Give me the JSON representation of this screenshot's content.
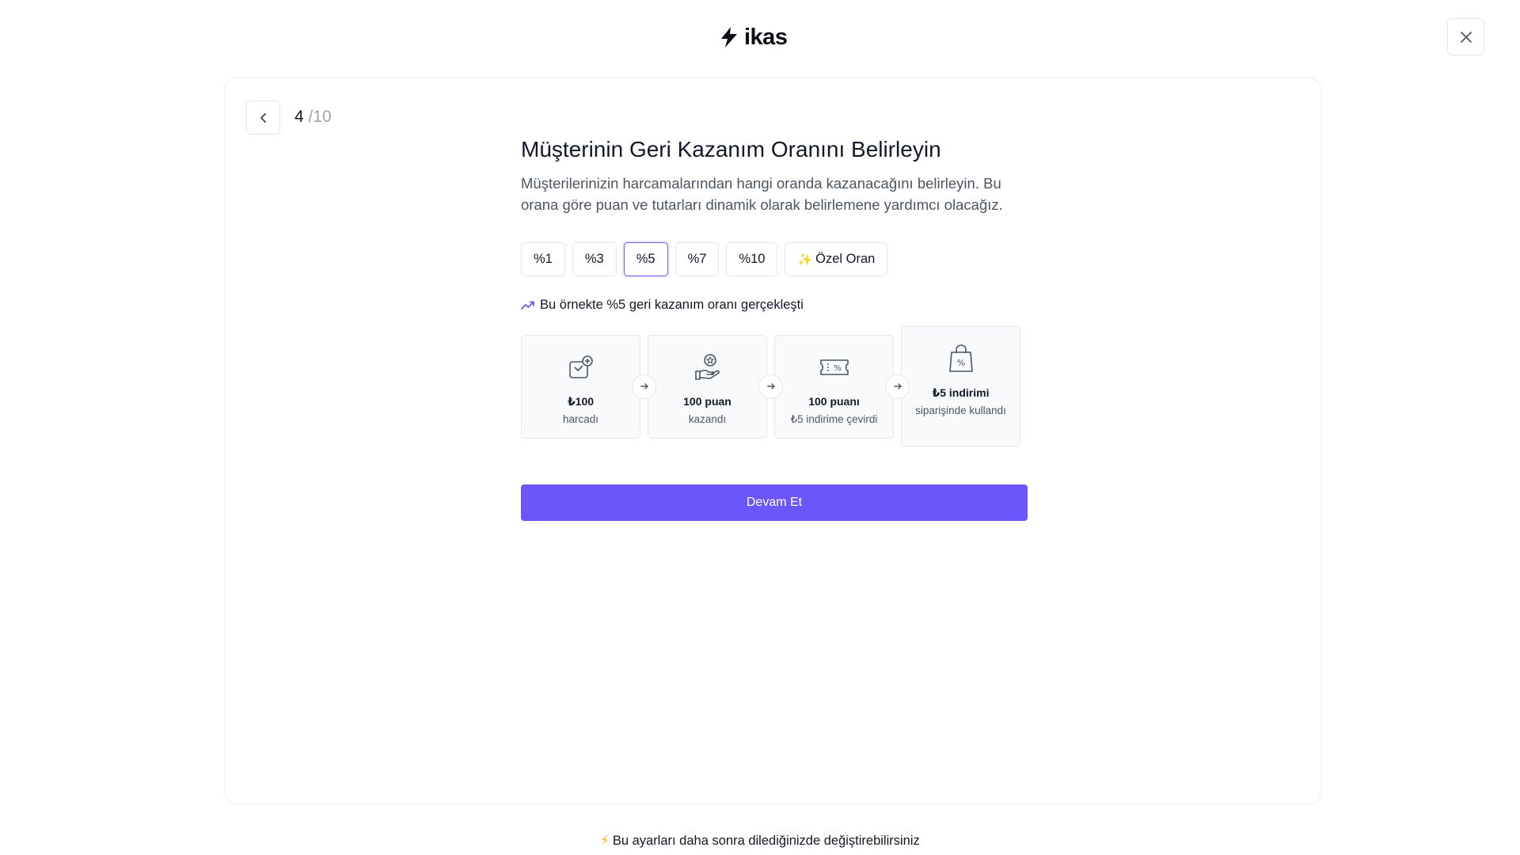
{
  "header": {
    "logo_text": "ikas"
  },
  "progress": {
    "current": "4",
    "total": "/10"
  },
  "main": {
    "title": "Müşterinin Geri Kazanım Oranını Belirleyin",
    "subtitle": "Müşterilerinizin harcamalarından hangi oranda kazanacağını belirleyin. Bu orana göre puan ve tutarları dinamik olarak belirlemene yardımcı olacağız.",
    "rates": [
      {
        "label": "%1"
      },
      {
        "label": "%3"
      },
      {
        "label": "%5",
        "selected": true
      },
      {
        "label": "%7"
      },
      {
        "label": "%10"
      },
      {
        "label": "Özel Oran",
        "icon": "sparkles-icon"
      }
    ],
    "example_text": "Bu örnekte %5 geri kazanım oranı gerçekleşti",
    "flow": [
      {
        "icon": "wallet-plus-icon",
        "value": "₺100",
        "desc": "harcadı"
      },
      {
        "icon": "hand-star-icon",
        "value": "100 puan",
        "desc": "kazandı"
      },
      {
        "icon": "ticket-percent-icon",
        "value": "100 puanı",
        "desc": "₺5 indirime çevirdi"
      },
      {
        "icon": "bag-percent-icon",
        "value": "₺5 indirimi",
        "desc": "siparişinde kullandı"
      }
    ],
    "cta_label": "Devam Et"
  },
  "footer": {
    "note": "Bu ayarları daha sonra dilediğinizde değiştirebilirsiniz"
  },
  "colors": {
    "accent": "#6c55fa",
    "selected_border": "#6d5efc",
    "spark": "#f4b400"
  }
}
